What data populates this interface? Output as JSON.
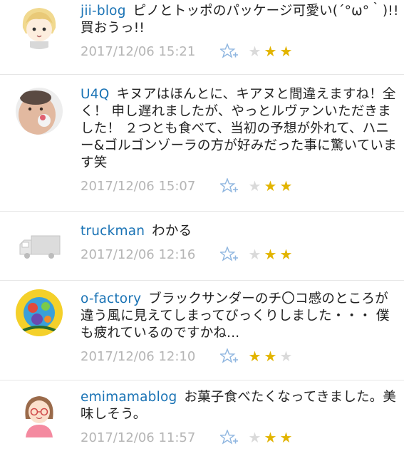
{
  "comments": [
    {
      "user": "jii-blog",
      "text": "ピノとトッポのパッケージ可愛い(´°ω°｀)!!買おうっ!!",
      "date": "2017/12/06 15:21",
      "stars_filled": 2,
      "stars_total": 3,
      "avatar": "anime-girl-avatar-icon"
    },
    {
      "user": "U4Q",
      "text": "キヌアはほんとに、キアヌと間違えますね！全く！ 申し遅れましたが、やっとルヴァンいただきました！ ２つとも食べて、当初の予想が外れて、ハニー&ゴルゴンゾーラの方が好みだった事に驚いています笑",
      "date": "2017/12/06 15:07",
      "stars_filled": 2,
      "stars_total": 3,
      "avatar": "baby-photo-avatar"
    },
    {
      "user": "truckman",
      "text": "わかる",
      "date": "2017/12/06 12:16",
      "stars_filled": 2,
      "stars_total": 3,
      "avatar": "truck-icon"
    },
    {
      "user": "o-factory",
      "text": "ブラックサンダーのチ〇コ感のところが違う風に見えてしまってびっくりしました・・・ 僕も疲れているのですかね...",
      "date": "2017/12/06 12:10",
      "stars_filled": 2,
      "stars_total": 3,
      "avatar": "colorful-illustration-avatar"
    },
    {
      "user": "emimamablog",
      "text": "お菓子食べたくなってきました。美味しそう。",
      "date": "2017/12/06 11:57",
      "stars_filled": 2,
      "stars_total": 3,
      "avatar": "woman-glasses-avatar-icon"
    }
  ],
  "colors": {
    "username": "#1a73b5",
    "date": "#b5b5b5",
    "star_on": "#e2b400",
    "star_off": "#dadada",
    "add_star": "#8fb6e0"
  }
}
